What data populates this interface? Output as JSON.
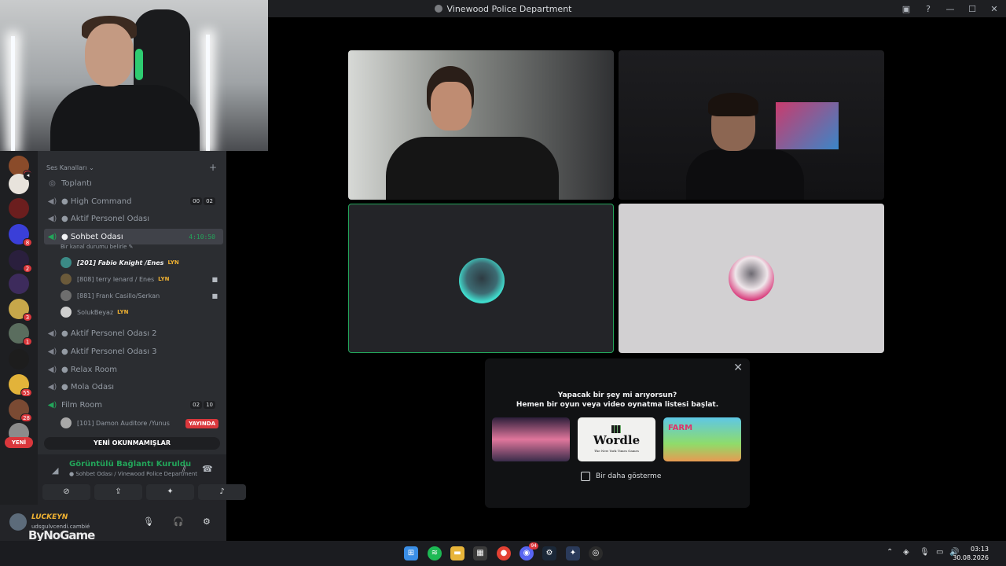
{
  "window": {
    "title": "Vinewood Police Department",
    "buttons": [
      "▣",
      "?",
      "—",
      "☐",
      "✕"
    ]
  },
  "servers": [
    {
      "badge": "1"
    },
    {
      "badge": ""
    },
    {
      "badge": ""
    },
    {
      "badge": "8"
    },
    {
      "badge": "2"
    },
    {
      "badge": ""
    },
    {
      "badge": "3"
    },
    {
      "badge": "1"
    },
    {
      "badge": ""
    },
    {
      "badge": "55"
    },
    {
      "badge": "28"
    },
    {
      "badge": ""
    }
  ],
  "new_pill": "YENİ",
  "category": {
    "label": "Ses Kanalları",
    "chevron": "⌄",
    "add": "+"
  },
  "channels": {
    "toplanti": "Toplantı",
    "high_command": "● High Command",
    "high_command_counts": [
      "00",
      "02"
    ],
    "aktif1": "● Aktif Personel Odası",
    "sohbet": "● Sohbet Odası",
    "sohbet_time": "4:10:50",
    "sohbet_status": "Bir kanal durumu belirle",
    "aktif2": "● Aktif Personel Odası 2",
    "aktif3": "● Aktif Personel Odası 3",
    "relax": "● Relax Room",
    "mola": "● Mola Odası",
    "film": "Film Room",
    "film_counts": [
      "02",
      "10"
    ]
  },
  "members": [
    {
      "name": "[201] Fabio Knight /Enes",
      "tag": "LYN"
    },
    {
      "name": "[808] terry lenard / Enes",
      "tag": "LYN"
    },
    {
      "name": "[881] Frank Casillo/Serkan",
      "tag": ""
    },
    {
      "name": "SolukBeyaz",
      "tag": "LYN"
    }
  ],
  "film_member": {
    "name": "[101] Damon Auditore /Yunus",
    "live": "YAYINDA"
  },
  "unread_bar": "YENİ OKUNMAMIŞLAR",
  "voice": {
    "status": "Görüntülü Bağlantı Kuruldu",
    "location": "● Sohbet Odası / Vinewood Police Department"
  },
  "user": {
    "name": "LUCKEYN",
    "status": "udsgulvcendi.cambié",
    "watermark": "ByNoGame"
  },
  "activity": {
    "line1": "Yapacak bir şey mi arıyorsun?",
    "line2": "Hemen bir oyun veya video oynatma listesi başlat.",
    "wordle": "Wordle",
    "wordle_sub": "The New York Times Games",
    "farm": "FARM",
    "dont_show": "Bir daha gösterme"
  },
  "taskbar": {
    "time": "03:13",
    "date": "30.08.2026",
    "discord_badge": "94"
  }
}
